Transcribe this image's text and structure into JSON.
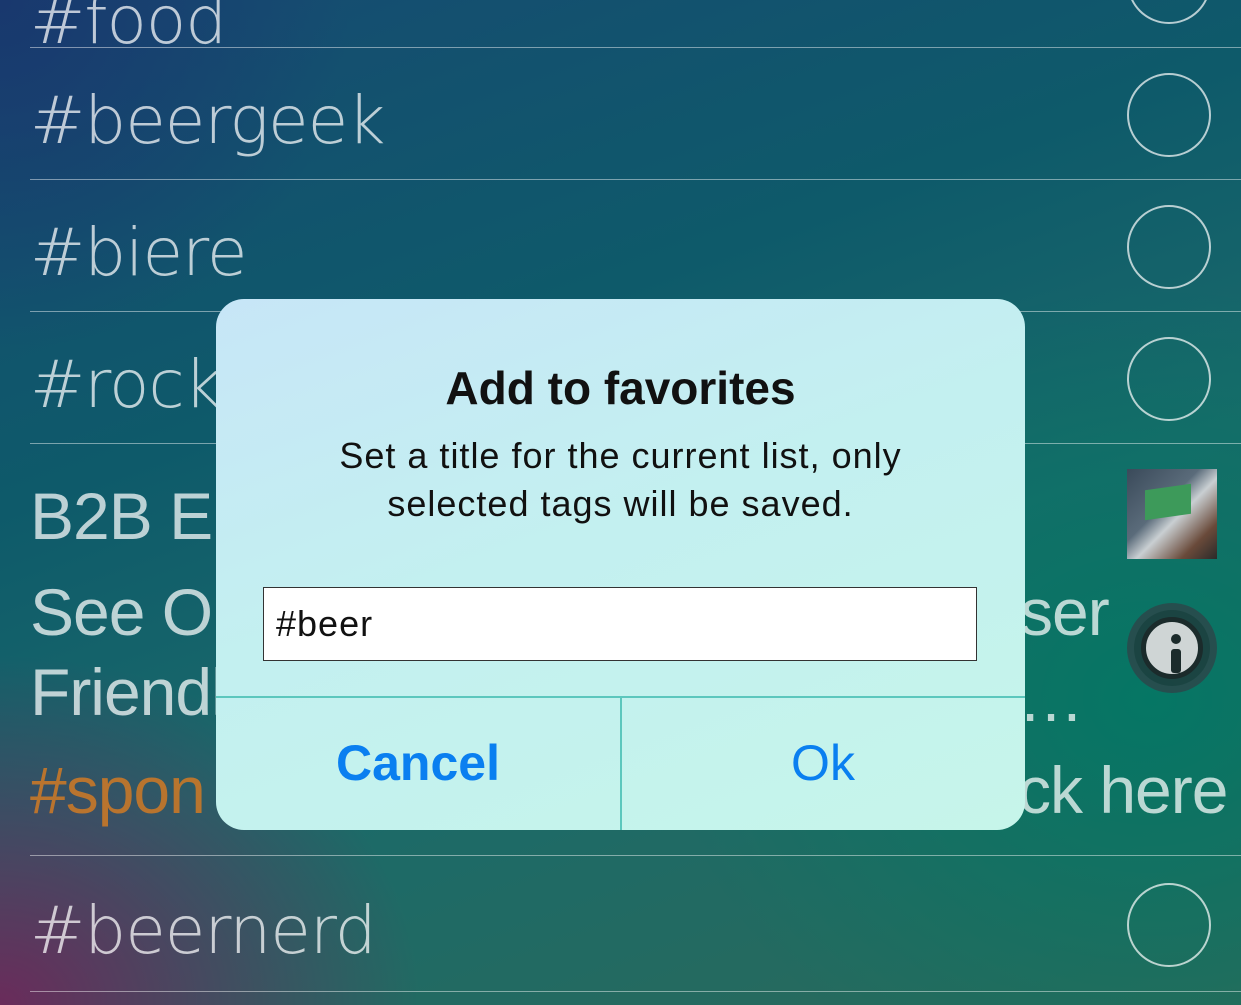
{
  "list": {
    "rows": [
      {
        "tag": "#food"
      },
      {
        "tag": "#beergeek"
      },
      {
        "tag": "#biere"
      },
      {
        "tag": "#rock"
      }
    ],
    "ad": {
      "title": "B2B E",
      "body_line1": "See O",
      "body_line1_tail": "ser",
      "body_line2": "Friendl",
      "ellipsis": "…",
      "sponsor": "#spon",
      "cta_tail": "ck here"
    },
    "last_row": {
      "tag": "#beernerd"
    }
  },
  "dialog": {
    "title": "Add to favorites",
    "message": "Set a title for the current list, only selected tags will be saved.",
    "input_value": "#beer",
    "cancel_label": "Cancel",
    "ok_label": "Ok"
  },
  "colors": {
    "accent": "#0a7ff0",
    "sponsor": "#c87828"
  },
  "icons": {
    "select": "empty-circle",
    "info": "info-icon",
    "thumbnail": "ad-thumbnail"
  }
}
